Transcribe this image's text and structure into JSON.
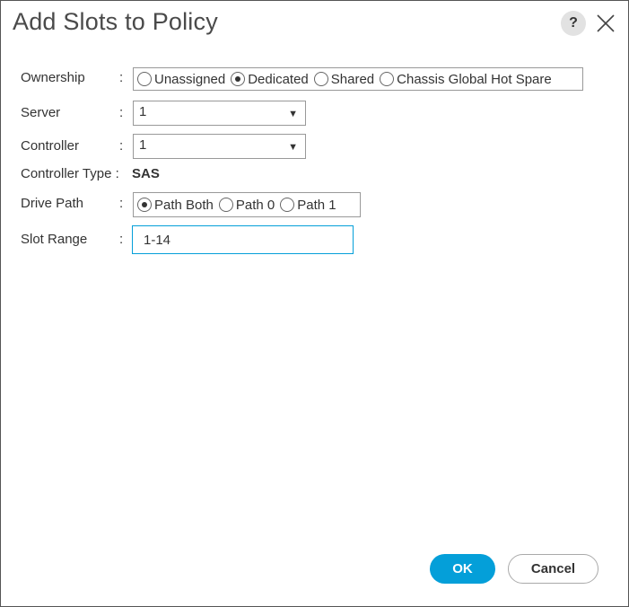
{
  "dialog": {
    "title": "Add Slots to Policy",
    "help_label": "?"
  },
  "form": {
    "ownership": {
      "label": "Ownership",
      "colon": ":",
      "options": [
        "Unassigned",
        "Dedicated",
        "Shared",
        "Chassis Global Hot Spare"
      ],
      "selected": "Dedicated"
    },
    "server": {
      "label": "Server",
      "colon": ":",
      "value": "1"
    },
    "controller": {
      "label": "Controller",
      "colon": ":",
      "value": "1"
    },
    "controller_type": {
      "label": "Controller Type :",
      "value": "SAS"
    },
    "drive_path": {
      "label": "Drive Path",
      "colon": ":",
      "options": [
        "Path Both",
        "Path 0",
        "Path 1"
      ],
      "selected": "Path Both"
    },
    "slot_range": {
      "label": "Slot Range",
      "colon": ":",
      "value": "1-14"
    }
  },
  "footer": {
    "ok_label": "OK",
    "cancel_label": "Cancel"
  },
  "colors": {
    "accent": "#049fd9"
  },
  "icons": {
    "close": "close-icon",
    "dropdown": "chevron-down-icon"
  }
}
